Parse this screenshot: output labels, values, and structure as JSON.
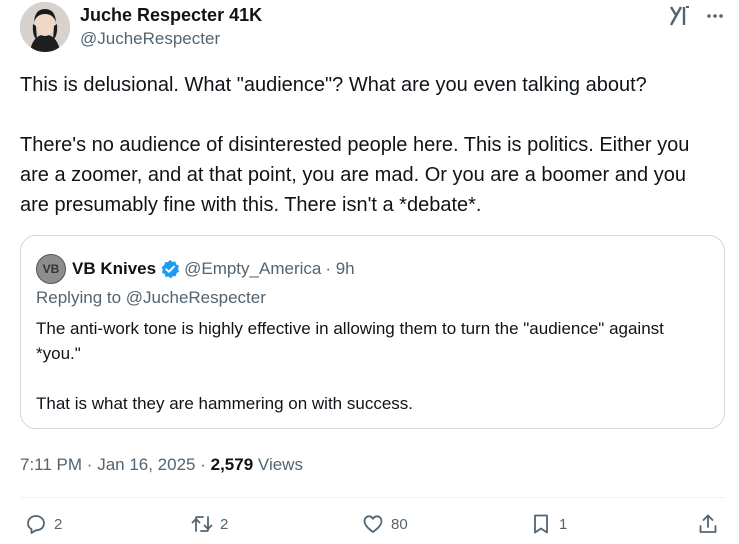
{
  "author": {
    "name": "Juche Respecter 41K",
    "handle": "@JucheRespecter"
  },
  "tweet": {
    "paragraphs": [
      "This is delusional. What \"audience\"? What are you even talking about?",
      "There's no audience of disinterested people here. This is politics. Either you are a zoomer, and at that point, you are mad. Or you are a boomer and you are presumably fine with this. There isn't a *debate*."
    ]
  },
  "quoted": {
    "avatar_text": "VB",
    "name": "VB Knives",
    "handle": "@Empty_America",
    "time": "· 9h",
    "replying_to": "Replying to @JucheRespecter",
    "paragraphs": [
      "The anti-work tone is highly effective in allowing them to turn the \"audience\" against *you.\"",
      "That is what they are hammering on with success."
    ]
  },
  "meta": {
    "time": "7:11 PM",
    "date": "Jan 16, 2025",
    "views_count": "2,579",
    "views_label": "Views"
  },
  "actions": {
    "replies": "2",
    "reposts": "2",
    "likes": "80",
    "bookmarks": "1"
  },
  "colors": {
    "text": "#0f1419",
    "secondary": "#536471",
    "verified": "#1d9bf0",
    "border": "#cfd9de"
  },
  "icons": [
    "grok-icon",
    "more-icon",
    "verified-badge-icon",
    "reply-icon",
    "repost-icon",
    "like-icon",
    "bookmark-icon",
    "share-icon"
  ]
}
